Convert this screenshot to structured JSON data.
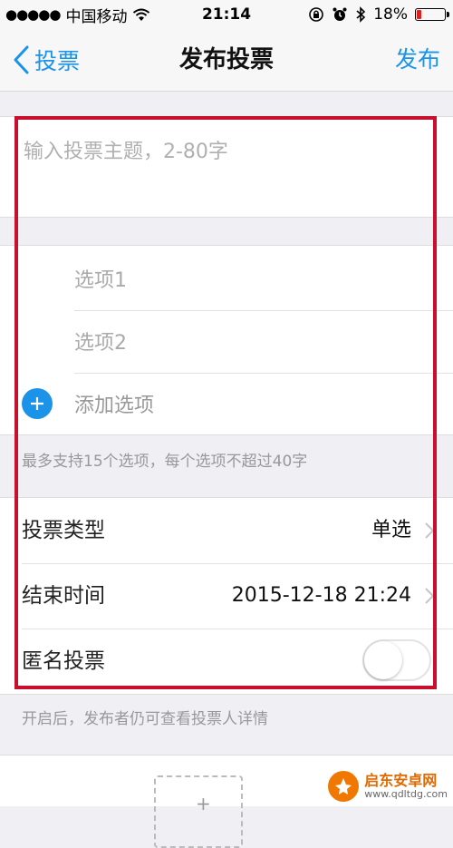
{
  "status_bar": {
    "signal_dots": "●●●●●",
    "carrier": "中国移动",
    "time": "21:14",
    "battery_text": "18%",
    "battery_level": 0.18
  },
  "nav": {
    "back_label": "投票",
    "title": "发布投票",
    "action_label": "发布"
  },
  "topic": {
    "placeholder": "输入投票主题，2-80字"
  },
  "options": {
    "items": [
      "选项1",
      "选项2"
    ],
    "add_label": "添加选项",
    "hint": "最多支持15个选项，每个选项不超过40字"
  },
  "settings": {
    "vote_type": {
      "label": "投票类型",
      "value": "单选"
    },
    "end_time": {
      "label": "结束时间",
      "value": "2015-12-18 21:24"
    },
    "anonymous": {
      "label": "匿名投票",
      "on": false
    },
    "hint": "开启后，发布者仍可查看投票人详情"
  },
  "watermark": {
    "name": "启东安卓网",
    "url": "www.qdltdg.com"
  },
  "colors": {
    "accent": "#1a93e8",
    "highlight": "#c8102e"
  }
}
